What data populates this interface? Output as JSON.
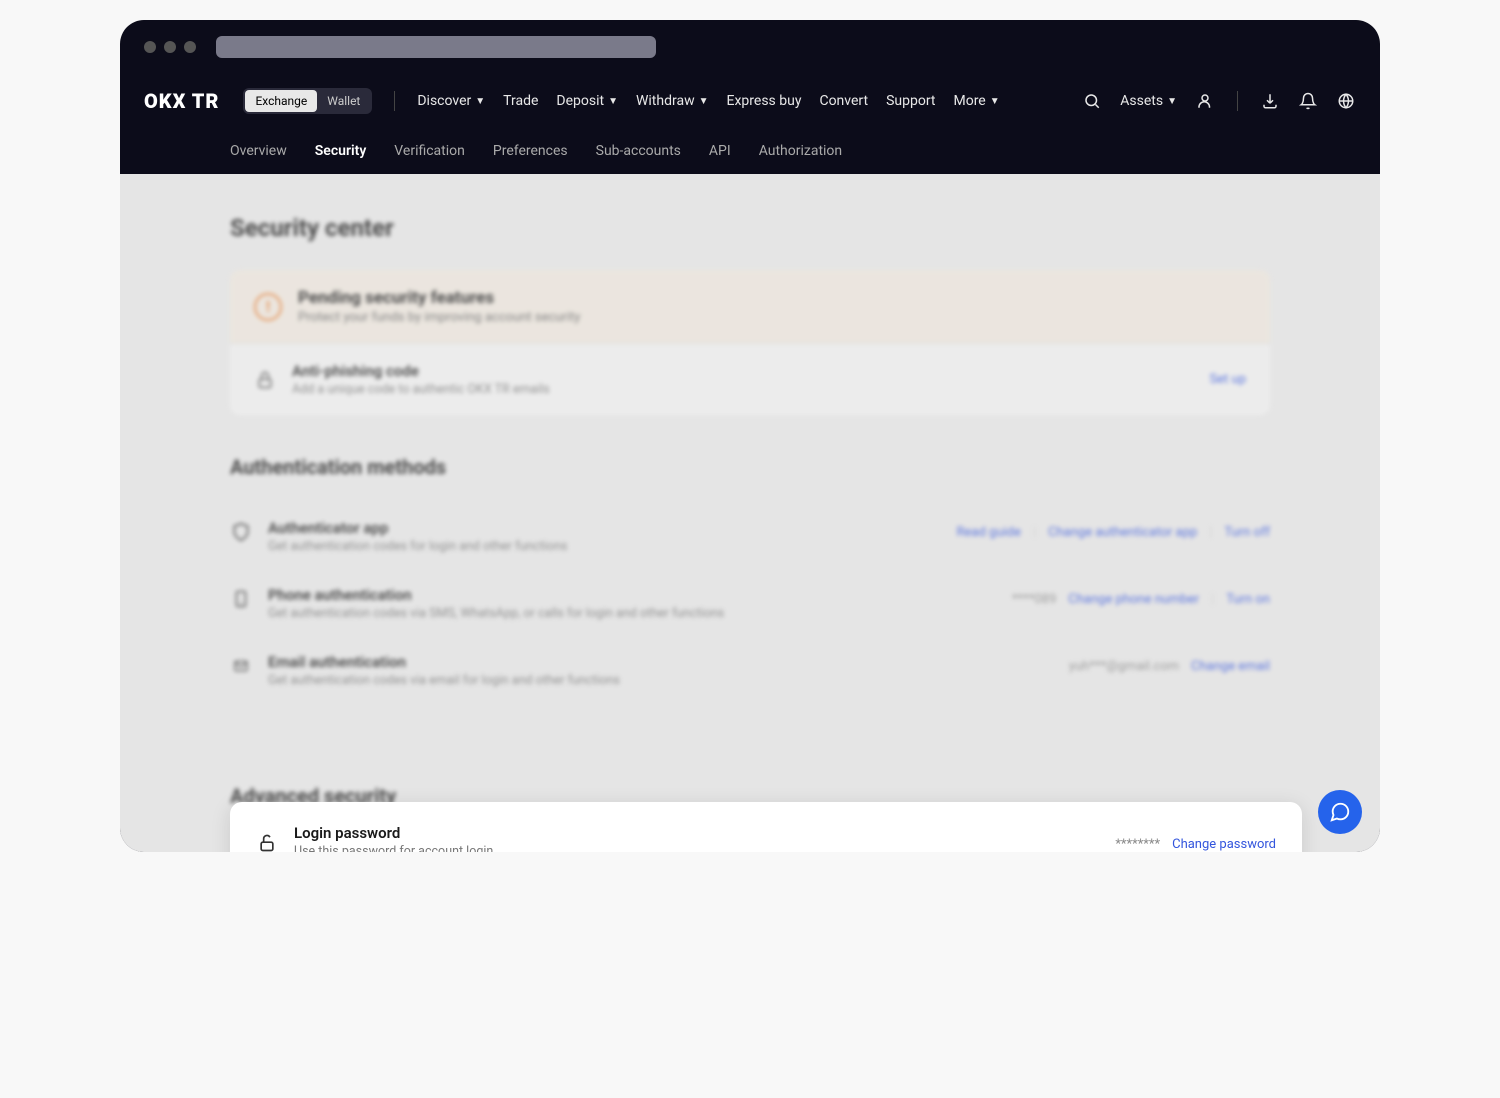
{
  "logo": "OKX TR",
  "mode_toggle": {
    "exchange": "Exchange",
    "wallet": "Wallet"
  },
  "topnav": {
    "discover": "Discover",
    "trade": "Trade",
    "deposit": "Deposit",
    "withdraw": "Withdraw",
    "express_buy": "Express buy",
    "convert": "Convert",
    "support": "Support",
    "more": "More",
    "assets": "Assets"
  },
  "subnav": {
    "overview": "Overview",
    "security": "Security",
    "verification": "Verification",
    "preferences": "Preferences",
    "sub_accounts": "Sub-accounts",
    "api": "API",
    "authorization": "Authorization"
  },
  "page": {
    "title": "Security center",
    "pending": {
      "title": "Pending security features",
      "desc": "Protect your funds by improving account security"
    },
    "anti_phishing": {
      "title": "Anti-phishing code",
      "desc": "Add a unique code to authentic OKX TR emails",
      "action": "Set up"
    },
    "auth_methods_title": "Authentication methods",
    "authenticator": {
      "title": "Authenticator app",
      "desc": "Get authentication codes for login and other functions",
      "read_guide": "Read guide",
      "change": "Change authenticator app",
      "turn_off": "Turn off"
    },
    "phone": {
      "title": "Phone authentication",
      "desc": "Get authentication codes via SMS, WhatsApp, or calls for login and other functions",
      "masked": "****089",
      "change": "Change phone number",
      "turn_on": "Turn on"
    },
    "email": {
      "title": "Email authentication",
      "desc": "Get authentication codes via email for login and other functions",
      "masked": "yuh***@gmail.com",
      "change": "Change email"
    },
    "login_password": {
      "title": "Login password",
      "desc": "Use this password for account login",
      "masked": "********",
      "change": "Change password"
    },
    "advanced_title": "Advanced security"
  }
}
